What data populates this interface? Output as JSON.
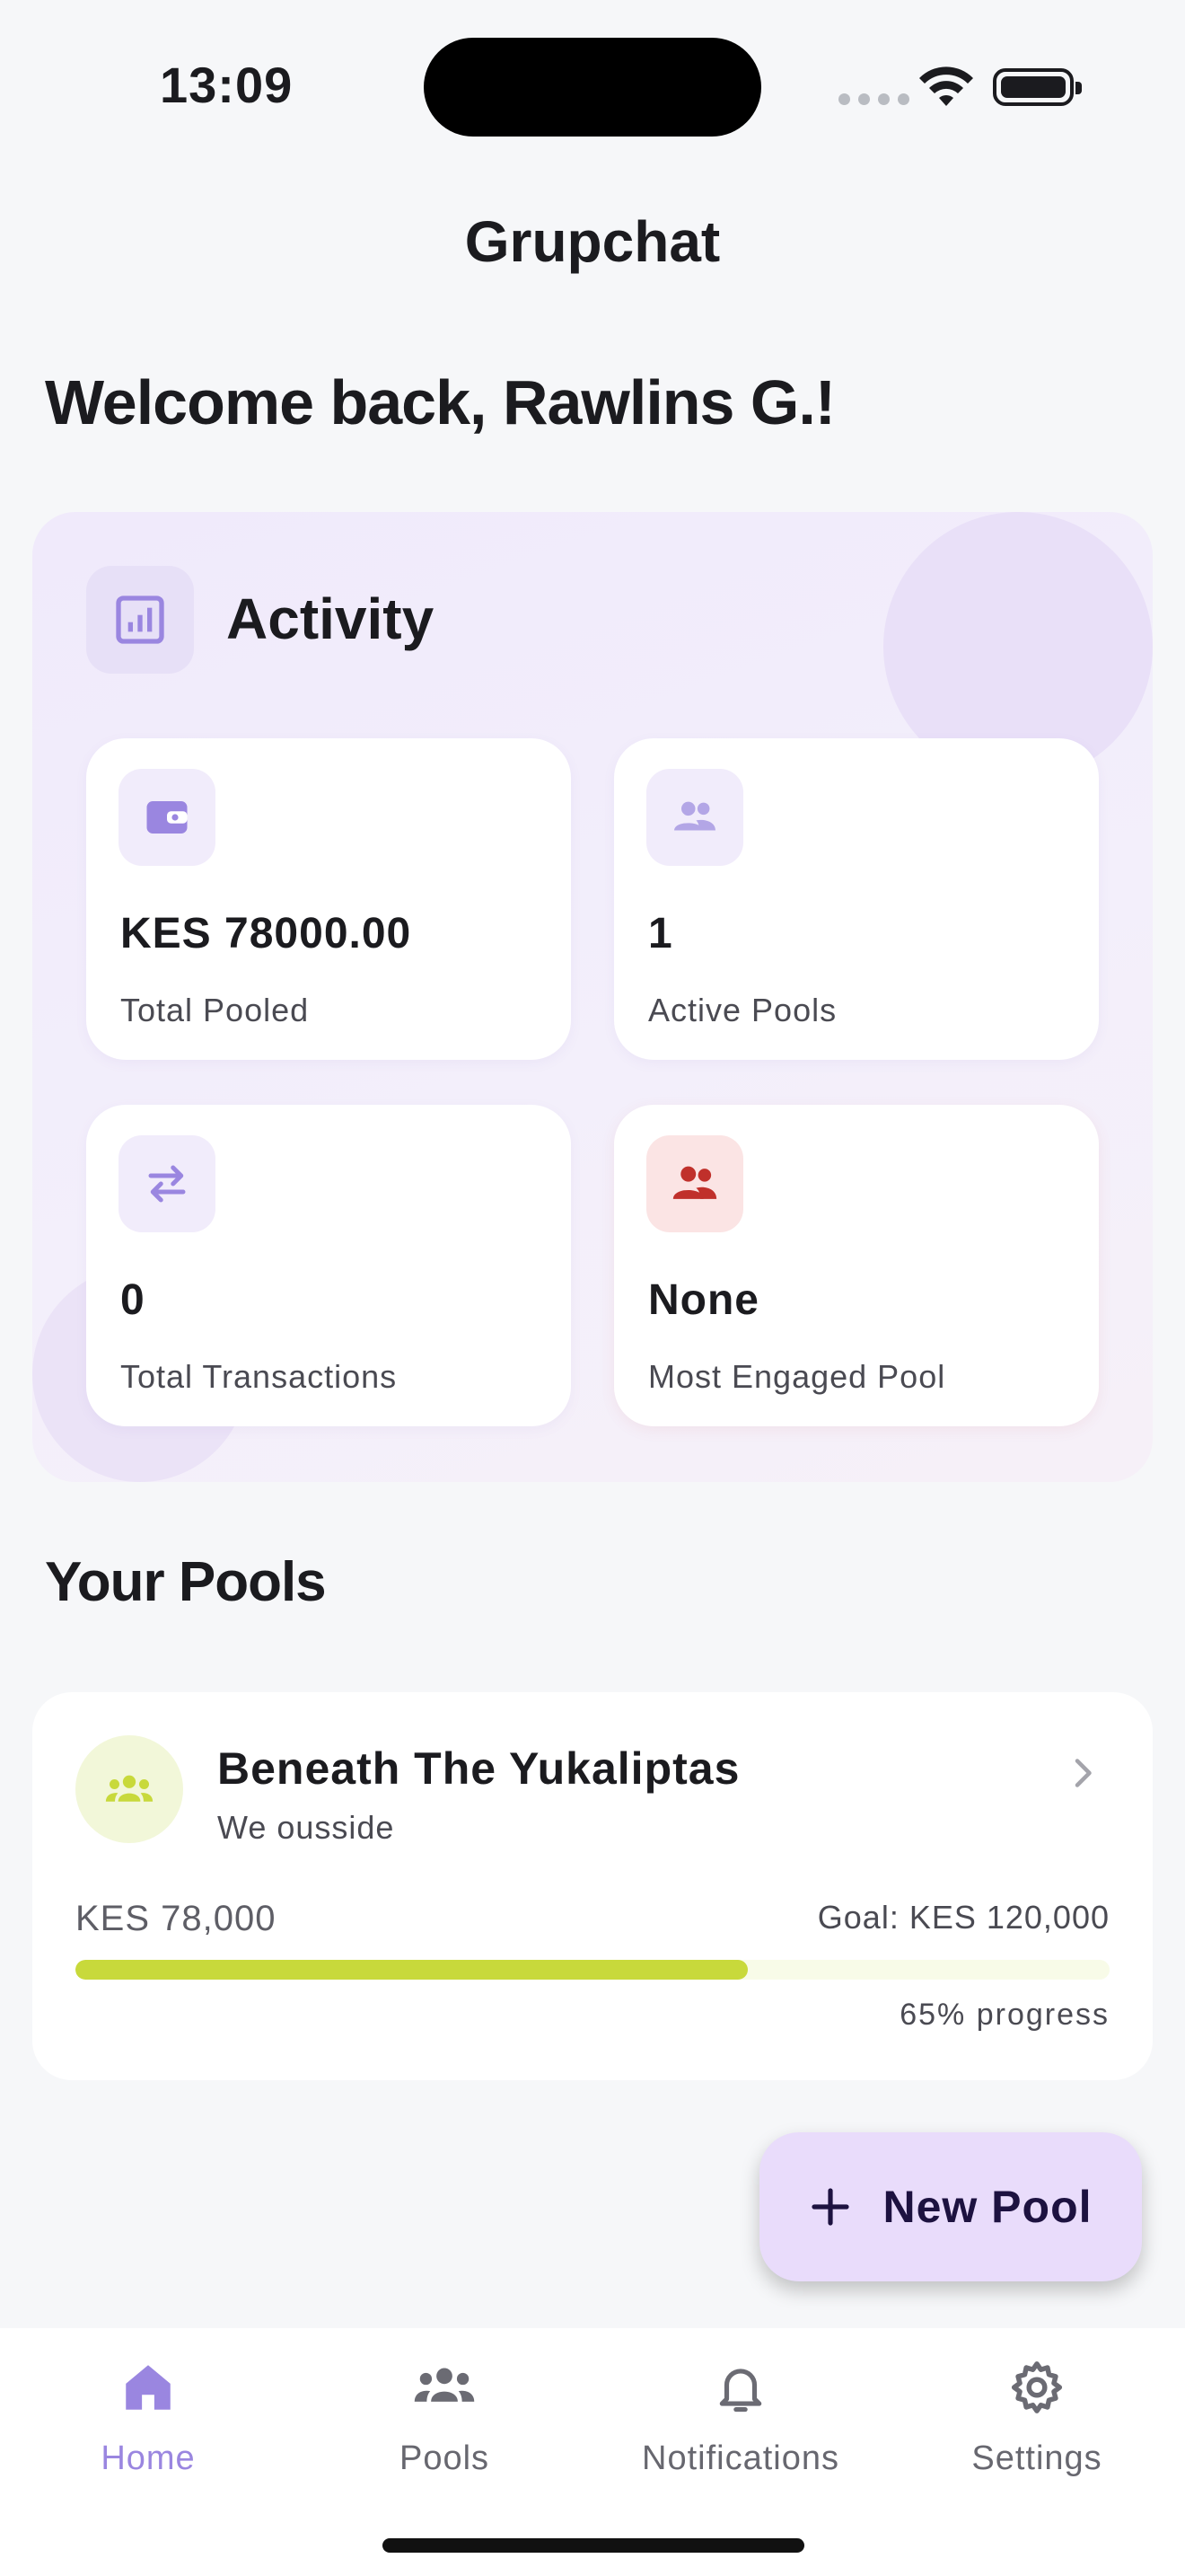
{
  "status_bar": {
    "time": "13:09"
  },
  "app": {
    "title": "Grupchat"
  },
  "welcome": {
    "text": "Welcome back, Rawlins G.!"
  },
  "activity": {
    "title": "Activity",
    "stats": [
      {
        "value": "KES 78000.00",
        "label": "Total Pooled",
        "icon": "wallet-icon"
      },
      {
        "value": "1",
        "label": "Active Pools",
        "icon": "group-icon"
      },
      {
        "value": "0",
        "label": "Total Transactions",
        "icon": "swap-arrows-icon"
      },
      {
        "value": "None",
        "label": "Most Engaged Pool",
        "icon": "people-icon"
      }
    ]
  },
  "pools_section": {
    "title": "Your Pools"
  },
  "pools": [
    {
      "name": "Beneath The Yukaliptas",
      "description": "We ousside",
      "amount": "KES 78,000",
      "goal": "Goal: KES 120,000",
      "progress_fraction": 0.65,
      "progress_text": "65% progress"
    }
  ],
  "fab": {
    "label": "New Pool",
    "icon": "plus-icon"
  },
  "nav": {
    "items": [
      {
        "label": "Home",
        "icon": "home-icon",
        "active": true
      },
      {
        "label": "Pools",
        "icon": "groups-icon",
        "active": false
      },
      {
        "label": "Notifications",
        "icon": "bell-icon",
        "active": false
      },
      {
        "label": "Settings",
        "icon": "gear-icon",
        "active": false
      }
    ]
  },
  "colors": {
    "accent": "#9a86e0",
    "progress": "#c8d93b",
    "fab_bg": "#e9dcfb",
    "danger_icon": "#c0302b"
  }
}
